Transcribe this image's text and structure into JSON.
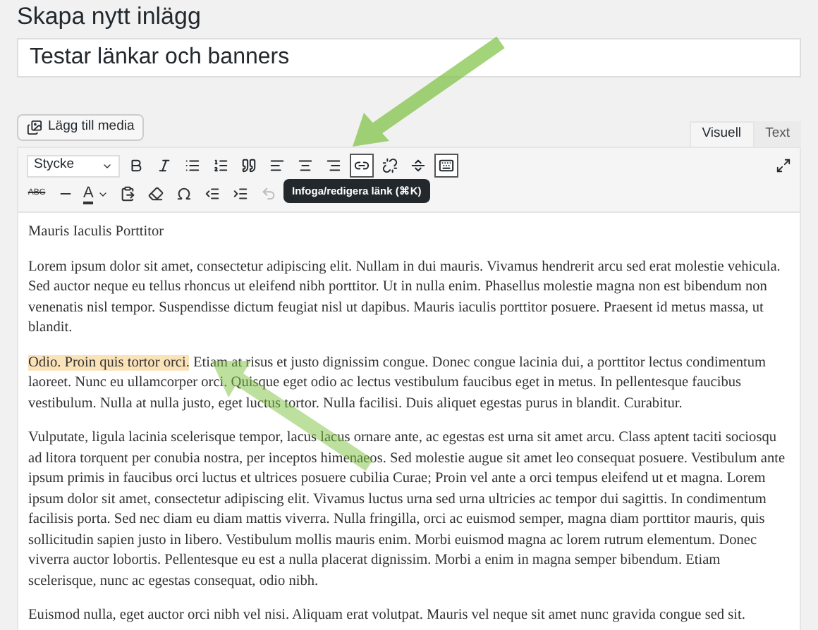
{
  "page_title": "Skapa nytt inlägg",
  "post_title": {
    "value": "Testar länkar och banners"
  },
  "media_button": "Lägg till media",
  "editor_tabs": [
    {
      "label": "Visuell",
      "selected": true
    },
    {
      "label": "Text",
      "selected": false
    }
  ],
  "format_select": "Stycke",
  "toolbar_row_1": [
    {
      "kind": "bold",
      "active": false
    },
    {
      "kind": "italic",
      "active": false
    },
    {
      "kind": "bullets",
      "active": false
    },
    {
      "kind": "numbers",
      "active": false
    },
    {
      "kind": "quote",
      "active": false
    },
    {
      "kind": "align-left",
      "active": false
    },
    {
      "kind": "align-center",
      "active": false
    },
    {
      "kind": "align-right",
      "active": false
    },
    {
      "kind": "link",
      "active": true
    },
    {
      "kind": "unlink",
      "active": false
    },
    {
      "kind": "more",
      "active": false
    },
    {
      "kind": "toolbar",
      "active": true
    }
  ],
  "toolbar_row_2": [
    {
      "kind": "strike",
      "label": "ABC",
      "disabled": false
    },
    {
      "kind": "rule",
      "disabled": false
    },
    {
      "kind": "color",
      "label": "A",
      "disabled": false
    },
    {
      "kind": "paste",
      "disabled": false
    },
    {
      "kind": "eraser",
      "disabled": false
    },
    {
      "kind": "omega",
      "disabled": false
    },
    {
      "kind": "outdent",
      "disabled": false
    },
    {
      "kind": "indent",
      "disabled": false
    },
    {
      "kind": "undo",
      "disabled": true
    }
  ],
  "tooltip": "Infoga/redigera länk (⌘K)",
  "content": [
    {
      "text": "Mauris Iaculis Porttitor"
    },
    {
      "text": "Lorem ipsum dolor sit amet, consectetur adipiscing elit. Nullam in dui mauris. Vivamus hendrerit arcu sed erat molestie vehicula. Sed auctor neque eu tellus rhoncus ut eleifend nibh porttitor. Ut in nulla enim. Phasellus molestie magna non est bibendum non venenatis nisl tempor. Suspendisse dictum feugiat nisl ut dapibus. Mauris iaculis porttitor posuere. Praesent id metus massa, ut blandit."
    },
    {
      "highlight": "Odio. Proin quis tortor orci.",
      "text": " Etiam at risus et justo dignissim congue. Donec congue lacinia dui, a porttitor lectus condimentum laoreet. Nunc eu ullamcorper orci. Quisque eget odio ac lectus vestibulum faucibus eget in metus. In pellentesque faucibus vestibulum. Nulla at nulla justo, eget luctus tortor. Nulla facilisi. Duis aliquet egestas purus in blandit. Curabitur."
    },
    {
      "text": "Vulputate, ligula lacinia scelerisque tempor, lacus lacus ornare ante, ac egestas est urna sit amet arcu. Class aptent taciti sociosqu ad litora torquent per conubia nostra, per inceptos himenaeos. Sed molestie augue sit amet leo consequat posuere. Vestibulum ante ipsum primis in faucibus orci luctus et ultrices posuere cubilia Curae; Proin vel ante a orci tempus eleifend ut et magna. Lorem ipsum dolor sit amet, consectetur adipiscing elit. Vivamus luctus urna sed urna ultricies ac tempor dui sagittis. In condimentum facilisis porta. Sed nec diam eu diam mattis viverra. Nulla fringilla, orci ac euismod semper, magna diam porttitor mauris, quis sollicitudin sapien justo in libero. Vestibulum mollis mauris enim. Morbi euismod magna ac lorem rutrum elementum. Donec viverra auctor lobortis. Pellentesque eu est a nulla placerat dignissim. Morbi a enim in magna semper bibendum. Etiam scelerisque, nunc ac egestas consequat, odio nibh."
    },
    {
      "text": "Euismod nulla, eget auctor orci nibh vel nisi. Aliquam erat volutpat. Mauris vel neque sit amet nunc gravida congue sed sit."
    }
  ]
}
